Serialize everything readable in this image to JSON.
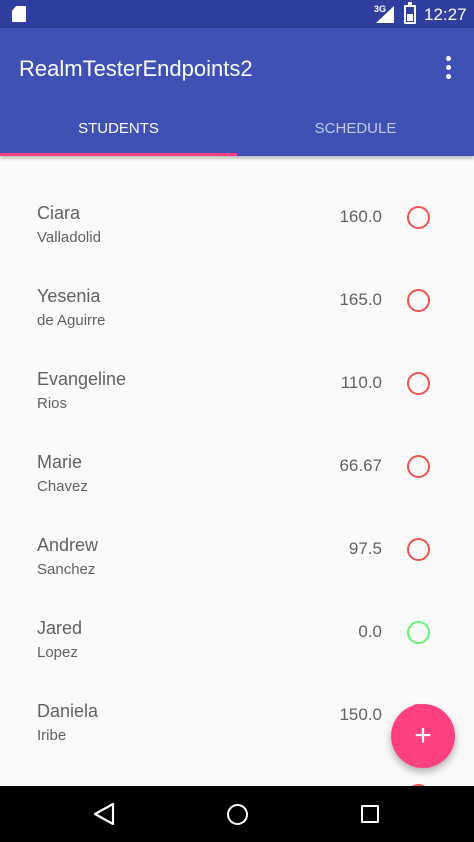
{
  "statusbar": {
    "network": "3G",
    "time": "12:27",
    "icons": [
      "sd-card-icon",
      "signal-icon",
      "battery-icon"
    ]
  },
  "appbar": {
    "title": "RealmTesterEndpoints2",
    "menu_icon": "overflow-menu-icon"
  },
  "tabs": [
    {
      "label": "STUDENTS",
      "active": true
    },
    {
      "label": "SCHEDULE",
      "active": false
    }
  ],
  "students": [
    {
      "first": "Ciara",
      "last": "Valladolid",
      "score": "160.0",
      "status_color": "#ef5350"
    },
    {
      "first": "Yesenia",
      "last": "de Aguirre",
      "score": "165.0",
      "status_color": "#ef5350"
    },
    {
      "first": "Evangeline",
      "last": "Rios",
      "score": "110.0",
      "status_color": "#ef5350"
    },
    {
      "first": "Marie",
      "last": "Chavez",
      "score": "66.67",
      "status_color": "#ef5350"
    },
    {
      "first": "Andrew",
      "last": "Sanchez",
      "score": "97.5",
      "status_color": "#ef5350"
    },
    {
      "first": "Jared",
      "last": "Lopez",
      "score": "0.0",
      "status_color": "#69f07a"
    },
    {
      "first": "Daniela",
      "last": "Iribe",
      "score": "150.0",
      "status_color": "#ef5350"
    }
  ],
  "fab": {
    "label": "+",
    "icon": "add-icon"
  },
  "colors": {
    "primary": "#3f51b5",
    "primary_dark": "#303f9f",
    "accent": "#ff4081"
  }
}
